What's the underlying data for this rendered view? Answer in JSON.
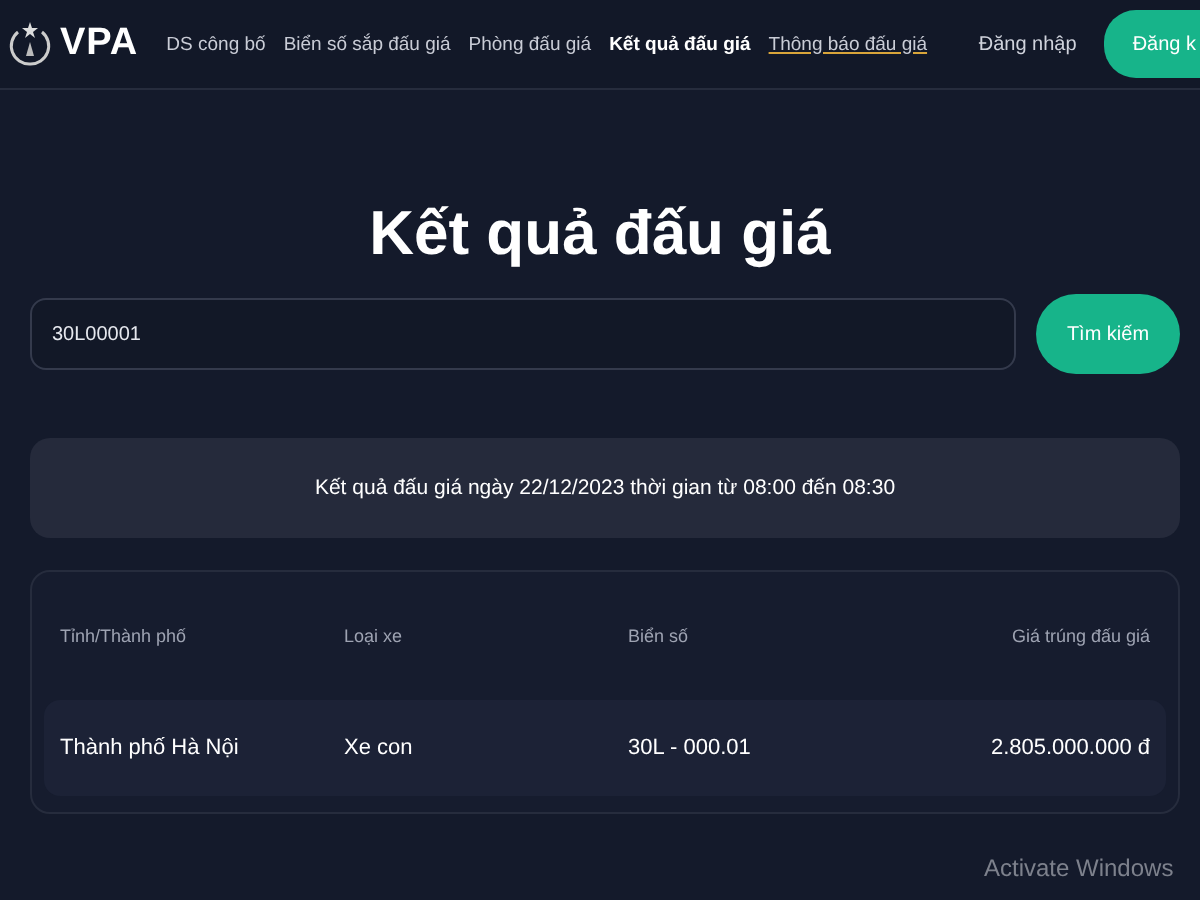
{
  "header": {
    "logo": "VPA",
    "nav": [
      {
        "label": "DS công bố",
        "selected": false,
        "underlined": false
      },
      {
        "label": "Biển số sắp đấu giá",
        "selected": false,
        "underlined": false
      },
      {
        "label": "Phòng đấu giá",
        "selected": false,
        "underlined": false
      },
      {
        "label": "Kết quả đấu giá",
        "selected": true,
        "underlined": false
      },
      {
        "label": "Thông báo đấu giá",
        "selected": false,
        "underlined": true
      }
    ],
    "login": "Đăng nhập",
    "register": "Đăng k"
  },
  "title": "Kết quả đấu giá",
  "search": {
    "value": "30L00001",
    "button": "Tìm kiếm"
  },
  "info": "Kết quả đấu giá ngày 22/12/2023 thời gian từ 08:00 đến 08:30",
  "table": {
    "columns": [
      "Tỉnh/Thành phố",
      "Loại xe",
      "Biển số",
      "Giá trúng đấu giá"
    ],
    "rows": [
      [
        "Thành phố Hà Nội",
        "Xe con",
        "30L - 000.01",
        "2.805.000.000 đ"
      ]
    ]
  },
  "os_notice": "Activate Windows"
}
